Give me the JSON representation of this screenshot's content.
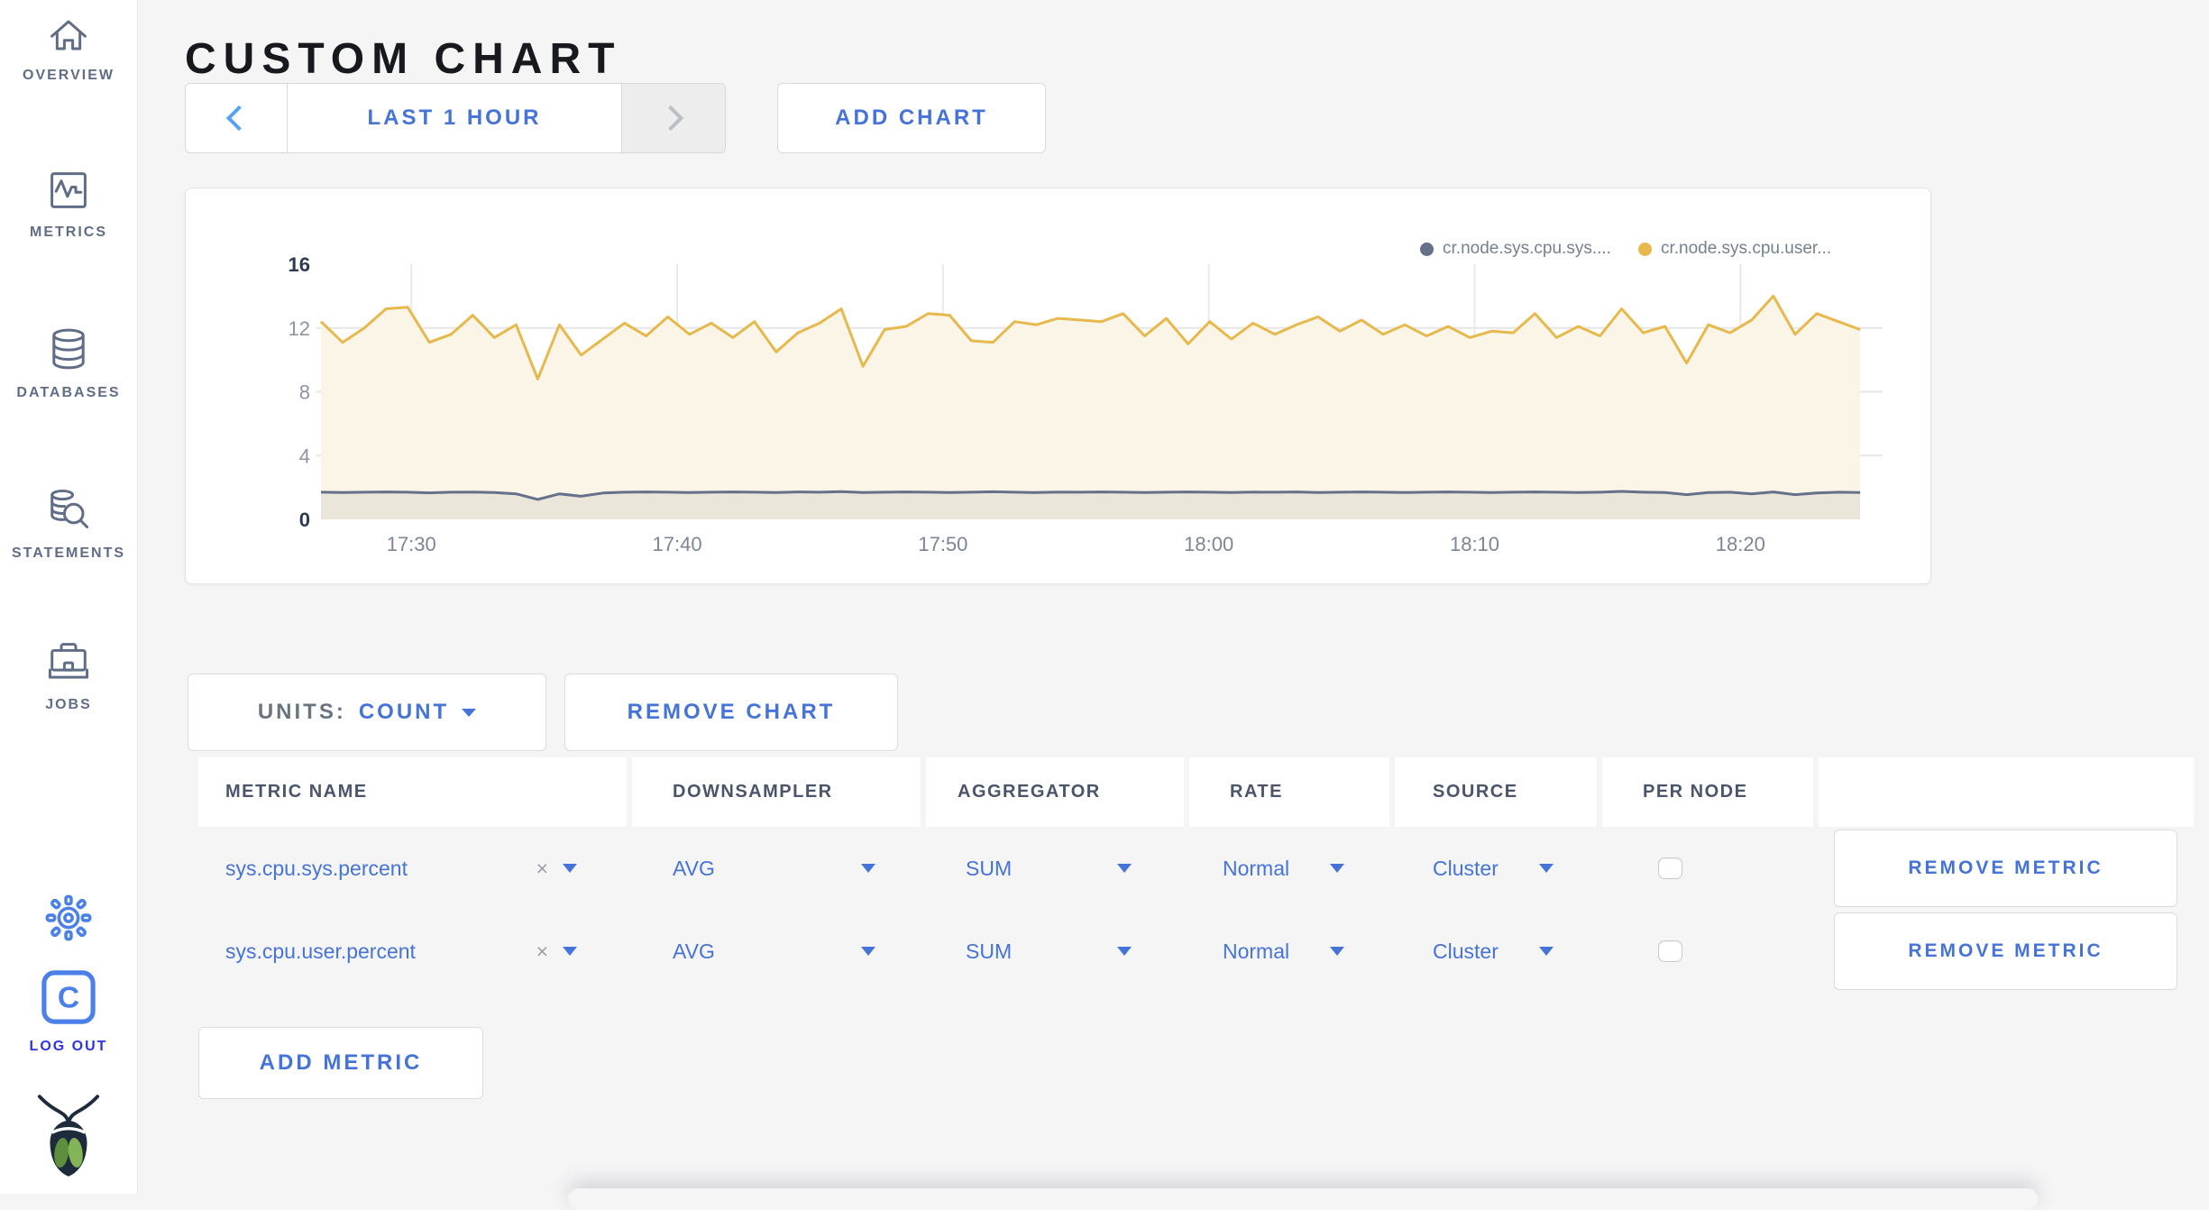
{
  "sidebar": {
    "items": [
      {
        "label": "OVERVIEW",
        "icon": "home-icon"
      },
      {
        "label": "METRICS",
        "icon": "metrics-icon"
      },
      {
        "label": "DATABASES",
        "icon": "database-icon"
      },
      {
        "label": "STATEMENTS",
        "icon": "statements-icon"
      },
      {
        "label": "JOBS",
        "icon": "jobs-icon"
      }
    ],
    "settings_icon": "gear-icon",
    "logout_label": "LOG OUT",
    "logo": "cockroachdb-bug-logo"
  },
  "header": {
    "title": "CUSTOM CHART"
  },
  "toolbar": {
    "time_range_label": "LAST 1 HOUR",
    "add_chart_label": "ADD CHART"
  },
  "chart_controls": {
    "units_prefix": "UNITS:",
    "units_value": "COUNT",
    "remove_chart_label": "REMOVE CHART",
    "add_metric_label": "ADD METRIC"
  },
  "chart_data": {
    "type": "line",
    "title": "",
    "xlabel": "",
    "ylabel": "",
    "ylim": [
      0,
      16
    ],
    "y_ticks": [
      0,
      4,
      8,
      12,
      16
    ],
    "x_tick_labels": [
      "17:30",
      "17:40",
      "17:50",
      "18:00",
      "18:10",
      "18:20"
    ],
    "x_tick_minutes": [
      3.4,
      13.4,
      23.4,
      33.4,
      43.4,
      53.4
    ],
    "x_minutes_range": [
      0,
      57.9
    ],
    "grid": true,
    "legend_position": "top-right",
    "series": [
      {
        "name": "cr.node.sys.cpu.sys....",
        "color": "#667089",
        "fill": "#eae6da",
        "values": [
          1.7,
          1.68,
          1.7,
          1.72,
          1.7,
          1.66,
          1.7,
          1.71,
          1.68,
          1.6,
          1.25,
          1.6,
          1.45,
          1.65,
          1.7,
          1.72,
          1.7,
          1.68,
          1.7,
          1.72,
          1.7,
          1.68,
          1.72,
          1.7,
          1.74,
          1.68,
          1.7,
          1.72,
          1.7,
          1.68,
          1.7,
          1.73,
          1.7,
          1.68,
          1.71,
          1.7,
          1.72,
          1.7,
          1.68,
          1.7,
          1.72,
          1.7,
          1.68,
          1.71,
          1.7,
          1.72,
          1.68,
          1.7,
          1.72,
          1.7,
          1.68,
          1.7,
          1.72,
          1.7,
          1.68,
          1.7,
          1.72,
          1.7,
          1.68,
          1.7,
          1.75,
          1.7,
          1.68,
          1.55,
          1.68,
          1.7,
          1.6,
          1.72,
          1.55,
          1.65,
          1.7,
          1.68
        ]
      },
      {
        "name": "cr.node.sys.cpu.user...",
        "color": "#e7b94c",
        "fill": "#faf5e7",
        "values": [
          12.4,
          11.1,
          12.0,
          13.2,
          13.3,
          11.1,
          11.6,
          12.8,
          11.4,
          12.2,
          8.8,
          12.2,
          10.3,
          11.3,
          12.3,
          11.5,
          12.7,
          11.6,
          12.3,
          11.4,
          12.4,
          10.5,
          11.7,
          12.3,
          13.2,
          9.6,
          11.9,
          12.1,
          12.9,
          12.8,
          11.2,
          11.1,
          12.4,
          12.2,
          12.6,
          12.5,
          12.4,
          12.9,
          11.5,
          12.6,
          11.0,
          12.4,
          11.3,
          12.3,
          11.6,
          12.2,
          12.7,
          11.8,
          12.5,
          11.6,
          12.2,
          11.5,
          12.1,
          11.4,
          11.8,
          11.7,
          12.9,
          11.4,
          12.1,
          11.5,
          13.2,
          11.7,
          12.1,
          9.8,
          12.2,
          11.7,
          12.5,
          14.0,
          11.6,
          12.9,
          12.4,
          11.9
        ]
      }
    ]
  },
  "table": {
    "columns": [
      "METRIC NAME",
      "DOWNSAMPLER",
      "AGGREGATOR",
      "RATE",
      "SOURCE",
      "PER NODE",
      ""
    ],
    "clear_glyph": "×",
    "rows": [
      {
        "metric_name": "sys.cpu.sys.percent",
        "downsampler": "AVG",
        "aggregator": "SUM",
        "rate": "Normal",
        "source": "Cluster",
        "per_node_checked": false,
        "remove_label": "REMOVE METRIC"
      },
      {
        "metric_name": "sys.cpu.user.percent",
        "downsampler": "AVG",
        "aggregator": "SUM",
        "rate": "Normal",
        "source": "Cluster",
        "per_node_checked": false,
        "remove_label": "REMOVE METRIC"
      }
    ]
  }
}
